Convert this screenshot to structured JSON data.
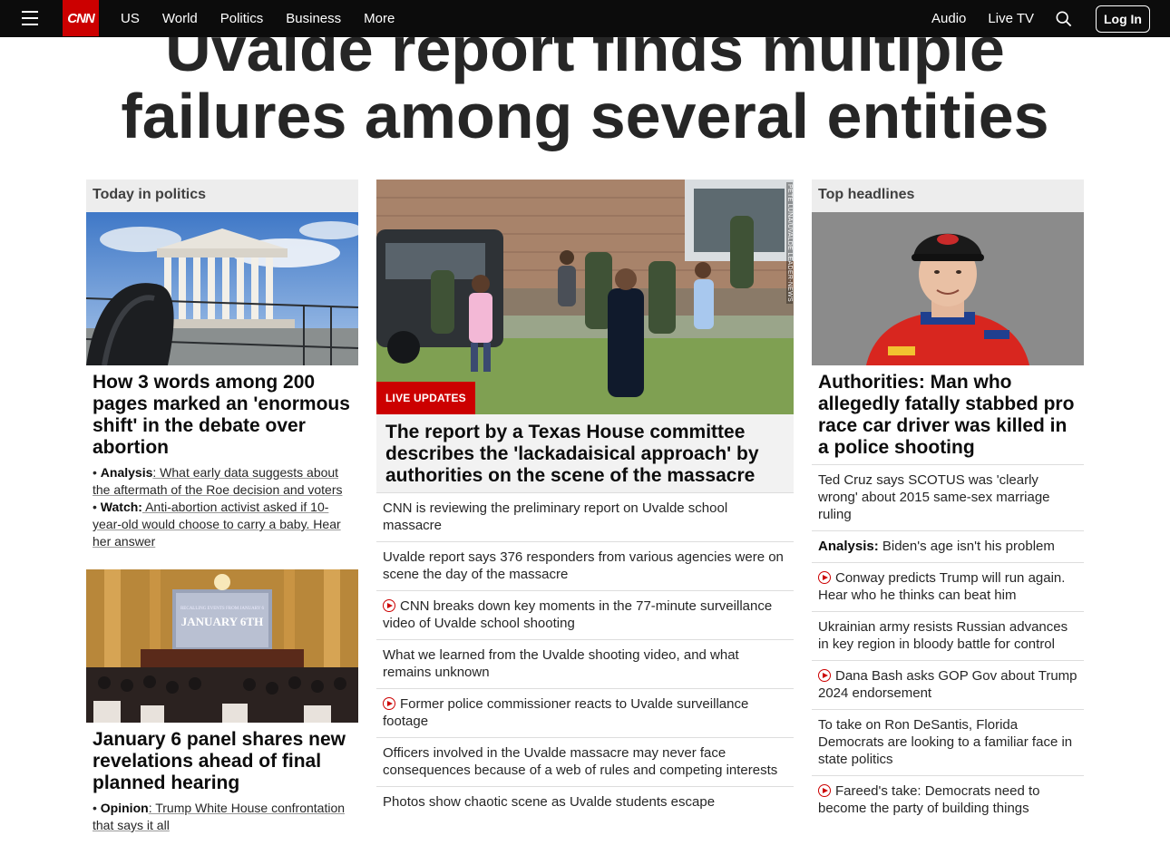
{
  "nav": {
    "links": [
      "US",
      "World",
      "Politics",
      "Business",
      "More"
    ],
    "right_links": [
      "Audio",
      "Live TV"
    ],
    "logo_text": "CNN",
    "login_label": "Log In",
    "brand_color": "#cc0000"
  },
  "headline": {
    "line1": "Uvalde report finds multiple",
    "line2": "failures among several entities"
  },
  "left": {
    "section_label": "Today in politics",
    "card1": {
      "title": "How 3 words among 200 pages marked an 'enormous shift' in the debate over abortion",
      "bullets": [
        {
          "prefix": "Analysis",
          "text": ": What early data suggests about the aftermath of the Roe decision and voters"
        },
        {
          "prefix": "Watch:",
          "text": " Anti-abortion activist asked if 10-year-old would choose to carry a baby. Hear her answer"
        }
      ]
    },
    "card2": {
      "image_text_small": "RECALLING EVENTS FROM JANUARY 6",
      "image_text": "JANUARY 6TH",
      "title": "January 6 panel shares new revelations ahead of final planned hearing",
      "bullets": [
        {
          "prefix": "Opinion",
          "text": ": Trump White House confrontation that says it all"
        }
      ]
    }
  },
  "middle": {
    "badge": "LIVE UPDATES",
    "credit": "PETE LUNA/UVALDE LEADER-NEWS",
    "title": "The report by a Texas House committee describes the 'lackadaisical approach' by authorities on the scene of the massacre",
    "items": [
      {
        "video": false,
        "text": "CNN is reviewing the preliminary report on Uvalde school massacre"
      },
      {
        "video": false,
        "text": "Uvalde report says 376 responders from various agencies were on scene the day of the massacre"
      },
      {
        "video": true,
        "text": "CNN breaks down key moments in the 77-minute surveillance video of Uvalde school shooting"
      },
      {
        "video": false,
        "text": "What we learned from the Uvalde shooting video, and what remains unknown"
      },
      {
        "video": true,
        "text": "Former police commissioner reacts to Uvalde surveillance footage"
      },
      {
        "video": false,
        "text": "Officers involved in the Uvalde massacre may never face consequences because of a web of rules and competing interests"
      },
      {
        "video": false,
        "text": "Photos show chaotic scene as Uvalde students escape"
      }
    ]
  },
  "right": {
    "section_label": "Top headlines",
    "title": "Authorities: Man who allegedly fatally stabbed pro race car driver was killed in a police shooting",
    "items": [
      {
        "video": false,
        "prefix": "",
        "text": "Ted Cruz says SCOTUS was 'clearly wrong' about 2015 same-sex marriage ruling"
      },
      {
        "video": false,
        "prefix": "Analysis:",
        "text": " Biden's age isn't his problem"
      },
      {
        "video": true,
        "prefix": "",
        "text": "Conway predicts Trump will run again. Hear who he thinks can beat him"
      },
      {
        "video": false,
        "prefix": "",
        "text": "Ukrainian army resists Russian advances in key region in bloody battle for control"
      },
      {
        "video": true,
        "prefix": "",
        "text": "Dana Bash asks GOP Gov about Trump 2024 endorsement"
      },
      {
        "video": false,
        "prefix": "",
        "text": "To take on Ron DeSantis, Florida Democrats are looking to a familiar face in state politics"
      },
      {
        "video": true,
        "prefix": "",
        "text": "Fareed's take: Democrats need to become the party of building things"
      }
    ]
  }
}
